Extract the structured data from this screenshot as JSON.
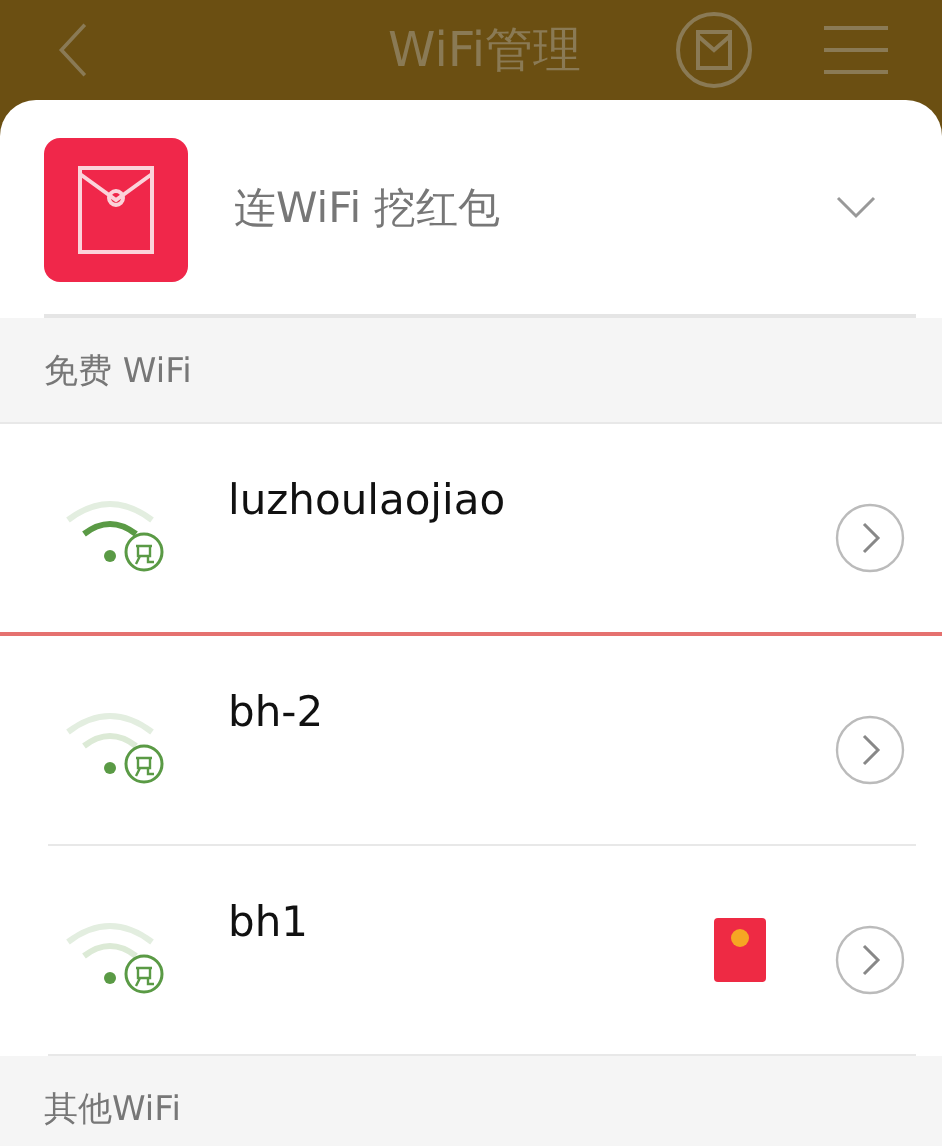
{
  "top_bar": {
    "title": "WiFi管理"
  },
  "promo": {
    "label": "连WiFi 挖红包",
    "expanded": false
  },
  "sections": [
    {
      "title": "免费 WiFi",
      "networks": [
        {
          "name": "luzhoulaojiao",
          "selected": true,
          "red_packet": false
        },
        {
          "name": "bh-2",
          "selected": false,
          "red_packet": false
        },
        {
          "name": "bh1",
          "selected": false,
          "red_packet": true
        }
      ]
    },
    {
      "title": "其他WiFi"
    }
  ]
}
